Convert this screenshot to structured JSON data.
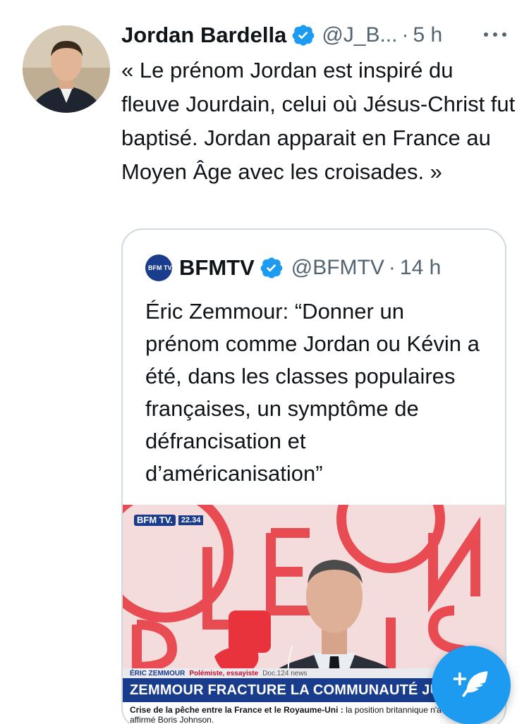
{
  "tweet": {
    "author_name": "Jordan Bardella",
    "handle": "@J_B...",
    "separator": "·",
    "time": "5 h",
    "text": "« Le prénom Jordan est inspiré du fleuve Jourdain, celui où Jésus-Christ fut baptisé. Jordan apparait en France au Moyen Âge avec les croisades. »"
  },
  "quote": {
    "logo_text": "BFM TV.",
    "author_name": "BFMTV",
    "handle": "@BFMTV",
    "separator": "·",
    "time": "14 h",
    "text": "Éric Zemmour: “Donner un prénom comme Jordan ou Kévin a été, dans les classes populaires françaises, un symptôme de défrancisation et d’américanisation”",
    "media": {
      "channel_logo": "BFM TV.",
      "clock": "22.34",
      "lower_third_name": "ÉRIC ZEMMOUR",
      "lower_third_role": "Polémiste, essayiste",
      "lower_third_tag": "Doc.124 news",
      "headline": "ZEMMOUR FRACTURE LA COMMUNAUTÉ JUIVE",
      "ticker_bold": "Crise de la pêche entre la France et le Royaume-Uni :",
      "ticker_rest": "la position britannique n'a pas changé, a affirmé Boris Johnson."
    }
  },
  "colors": {
    "verified": "#1d9bf0",
    "fab": "#1d9bf0",
    "secondary_text": "#536471",
    "bfm_blue": "#1a3c8c"
  },
  "icons": {
    "more": "more-horizontal-icon",
    "verified": "verified-badge-icon",
    "compose": "compose-tweet-icon"
  }
}
